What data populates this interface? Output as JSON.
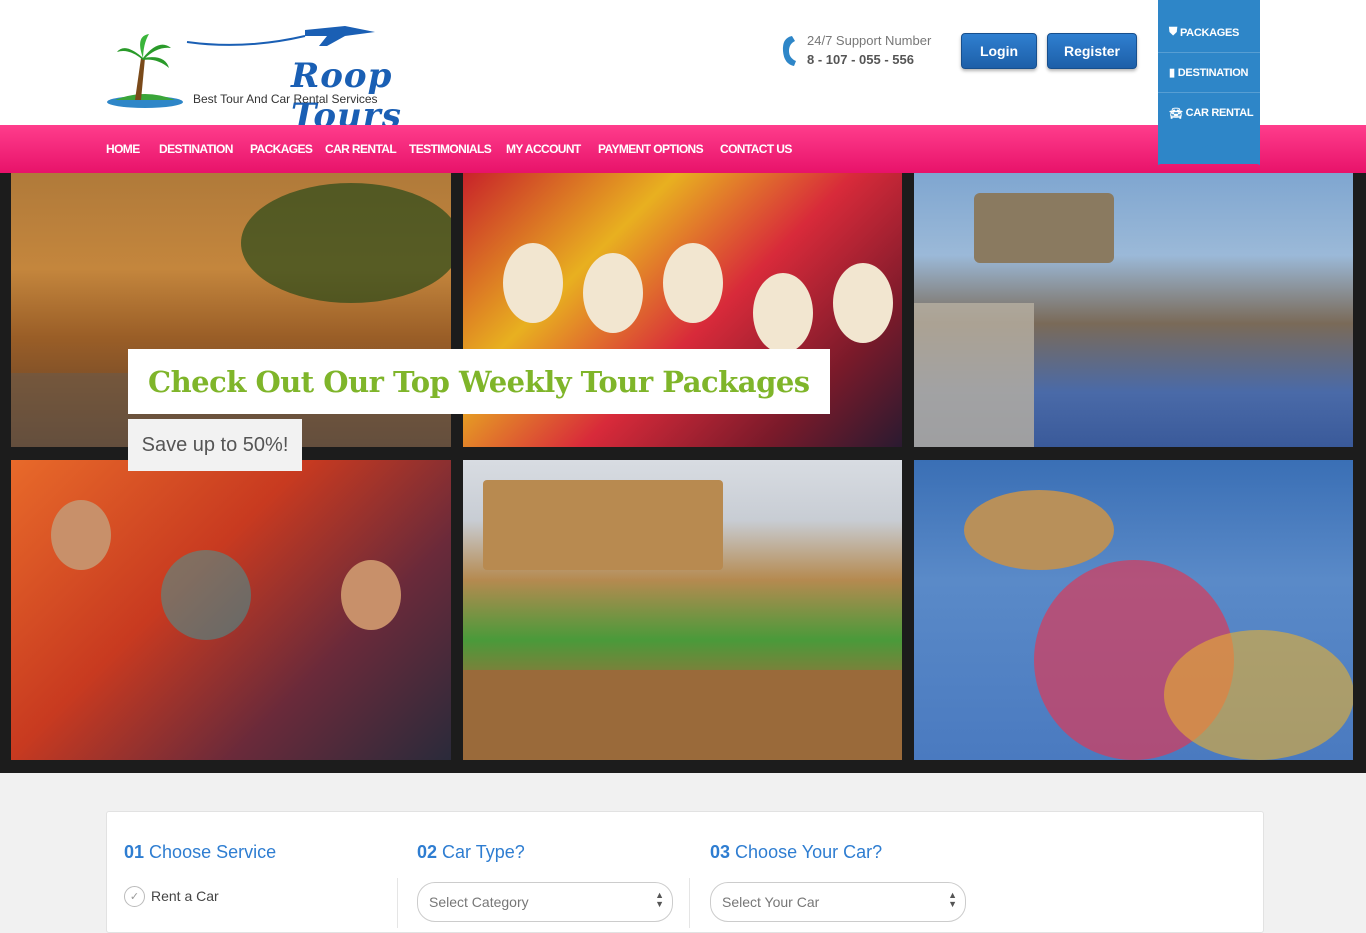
{
  "header": {
    "logo_text": "Roop Tours",
    "tagline": "Best Tour And Car Rental Services",
    "support_label": "24/7 Support Number",
    "support_number": "8 - 107 - 055 - 556",
    "login_label": "Login",
    "register_label": "Register"
  },
  "ribbon": {
    "items": [
      {
        "label": "PACKAGES",
        "icon": "shield-icon"
      },
      {
        "label": "DESTINATION",
        "icon": "building-icon"
      },
      {
        "label": "CAR RENTAL",
        "icon": "car-icon"
      }
    ]
  },
  "nav": {
    "items": [
      "HOME",
      "DESTINATION",
      "PACKAGES",
      "CAR RENTAL",
      "TESTIMONIALS",
      "MY ACCOUNT",
      "PAYMENT OPTIONS",
      "CONTACT US"
    ]
  },
  "hero": {
    "headline": "Check Out Our Top Weekly Tour Packages",
    "subline": "Save up to 50%!"
  },
  "booking": {
    "step1_num": "01",
    "step1_title": "Choose Service",
    "step1_option": "Rent a Car",
    "step2_num": "02",
    "step2_title": "Car Type?",
    "step2_select": "Select Category",
    "step3_num": "03",
    "step3_title": "Choose Your Car?",
    "step3_select": "Select Your Car"
  },
  "colors": {
    "nav_pink": "#ff3d8c",
    "brand_blue": "#2e86c8",
    "headline_green": "#7fb52a"
  }
}
